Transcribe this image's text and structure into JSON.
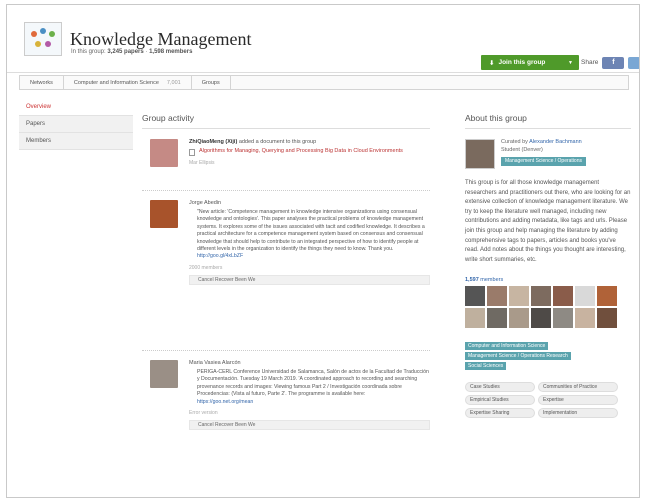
{
  "group": {
    "title": "Knowledge Management",
    "stats_prefix": "In this group:",
    "papers": "3,245 papers",
    "members": "1,598 members"
  },
  "header": {
    "join_label": "Join this group",
    "share_label": "Share"
  },
  "tabs": [
    {
      "label": "Networks"
    },
    {
      "label": "Computer and Information Science",
      "count": "7,001"
    },
    {
      "label": "Groups"
    }
  ],
  "leftnav": [
    "Overview",
    "Papers",
    "Members"
  ],
  "activity": {
    "heading": "Group activity",
    "posts": [
      {
        "author": "ZhiQiaoMeng (Xiji)",
        "action": "added a document to this group",
        "doc_title": "Algorithms for Managing, Querying and Processing Big Data in Cloud Environments",
        "meta": "Mar Ellipsis",
        "avatar_color": "#c58a85"
      },
      {
        "author": "Jorge Abedin",
        "text": "\"New article: 'Competence management in knowledge intensive organizations using consensual knowledge and ontologies'. This paper analyses the practical problems of knowledge management systems. It explores some of the issues associated with tacit and codified knowledge. It describes a practical architecture for a competence management system based on consensus and consensual knowledge that should help to contribute to an integrated perspective of how to identify people at different levels in the organization to identify the things they need to know. Thank you.",
        "link": "http://goo.gl/4xLbZF",
        "meta": "2000 members",
        "comment": "Cancel Recover Been We",
        "avatar_color": "#a8532b"
      },
      {
        "author": "Maria Vasiea Alarcón",
        "text": "PERIGA-CERL Conference Universidad de Salamanca, Salón de actos de la Facultad de Traducción y Documentación. Tuesday 19 March 2019. 'A coordinated approach to recording and searching provenance records and images: Viewing famous Part 2 / Investigación coordinada sobre Procedencias: (Vista al futuro, Parte 2'. The programme is available here:",
        "link": "https://goo.net.org/mean",
        "meta": "Error version",
        "comment": "Cancel Recover Been We",
        "avatar_color": "#9a8f86"
      }
    ]
  },
  "about": {
    "heading": "About this group",
    "curated_by": "Curated by",
    "curator": "Alexander Bachmann",
    "curator_role": "Student (Denver)",
    "curator_badge": "Management Science / Operations",
    "description": "This group is for all those knowledge management researchers and practitioners out there, who are looking for an extensive collection of knowledge management literature. We try to keep the literature well managed, including new contributions and adding metadata, like tags and urls. Please join this group and help managing the literature by adding comprehensive tags to papers, articles and books you've read. Add notes about the things you thought are interesting, write short summaries, etc.",
    "members_count": "1,597",
    "members_label": "members",
    "categories": [
      "Computer and Information Science",
      "Management Science / Operations Research",
      "Social Sciences"
    ],
    "tags": [
      "Case Studies",
      "Communities of Practice",
      "Empirical Studies",
      "Expertise",
      "Expertise Sharing",
      "Implementation"
    ]
  },
  "colors": {
    "join_green": "#4f9a2a",
    "badge_teal": "#5aa3ad",
    "link_blue": "#3366aa",
    "active_red": "#cc3333"
  }
}
